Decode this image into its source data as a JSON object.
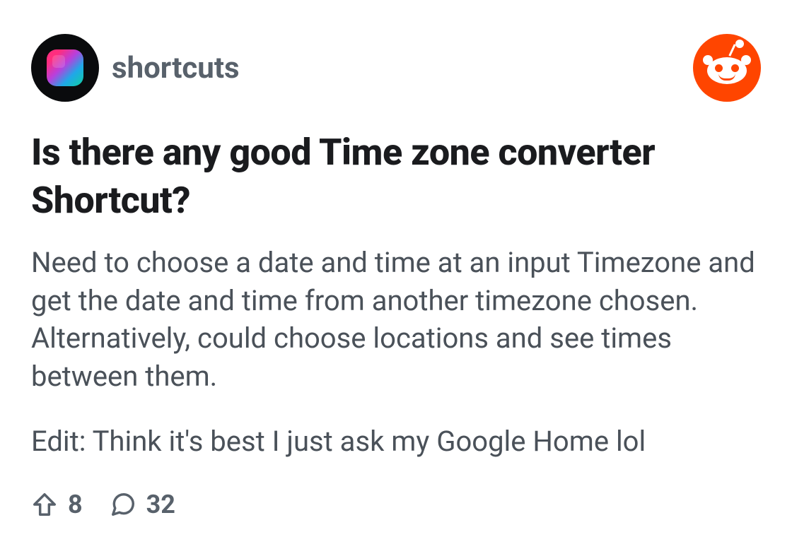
{
  "header": {
    "subreddit_name": "shortcuts"
  },
  "post": {
    "title": "Is there any good Time zone converter Shortcut?",
    "body_p1": "Need to choose a date and time at an input Timezone and get the date and time from another timezone chosen. Alternatively, could choose locations and see times between them.",
    "body_p2": "Edit: Think it's best I just ask my Google Home lol"
  },
  "footer": {
    "upvotes": "8",
    "comments": "32"
  }
}
